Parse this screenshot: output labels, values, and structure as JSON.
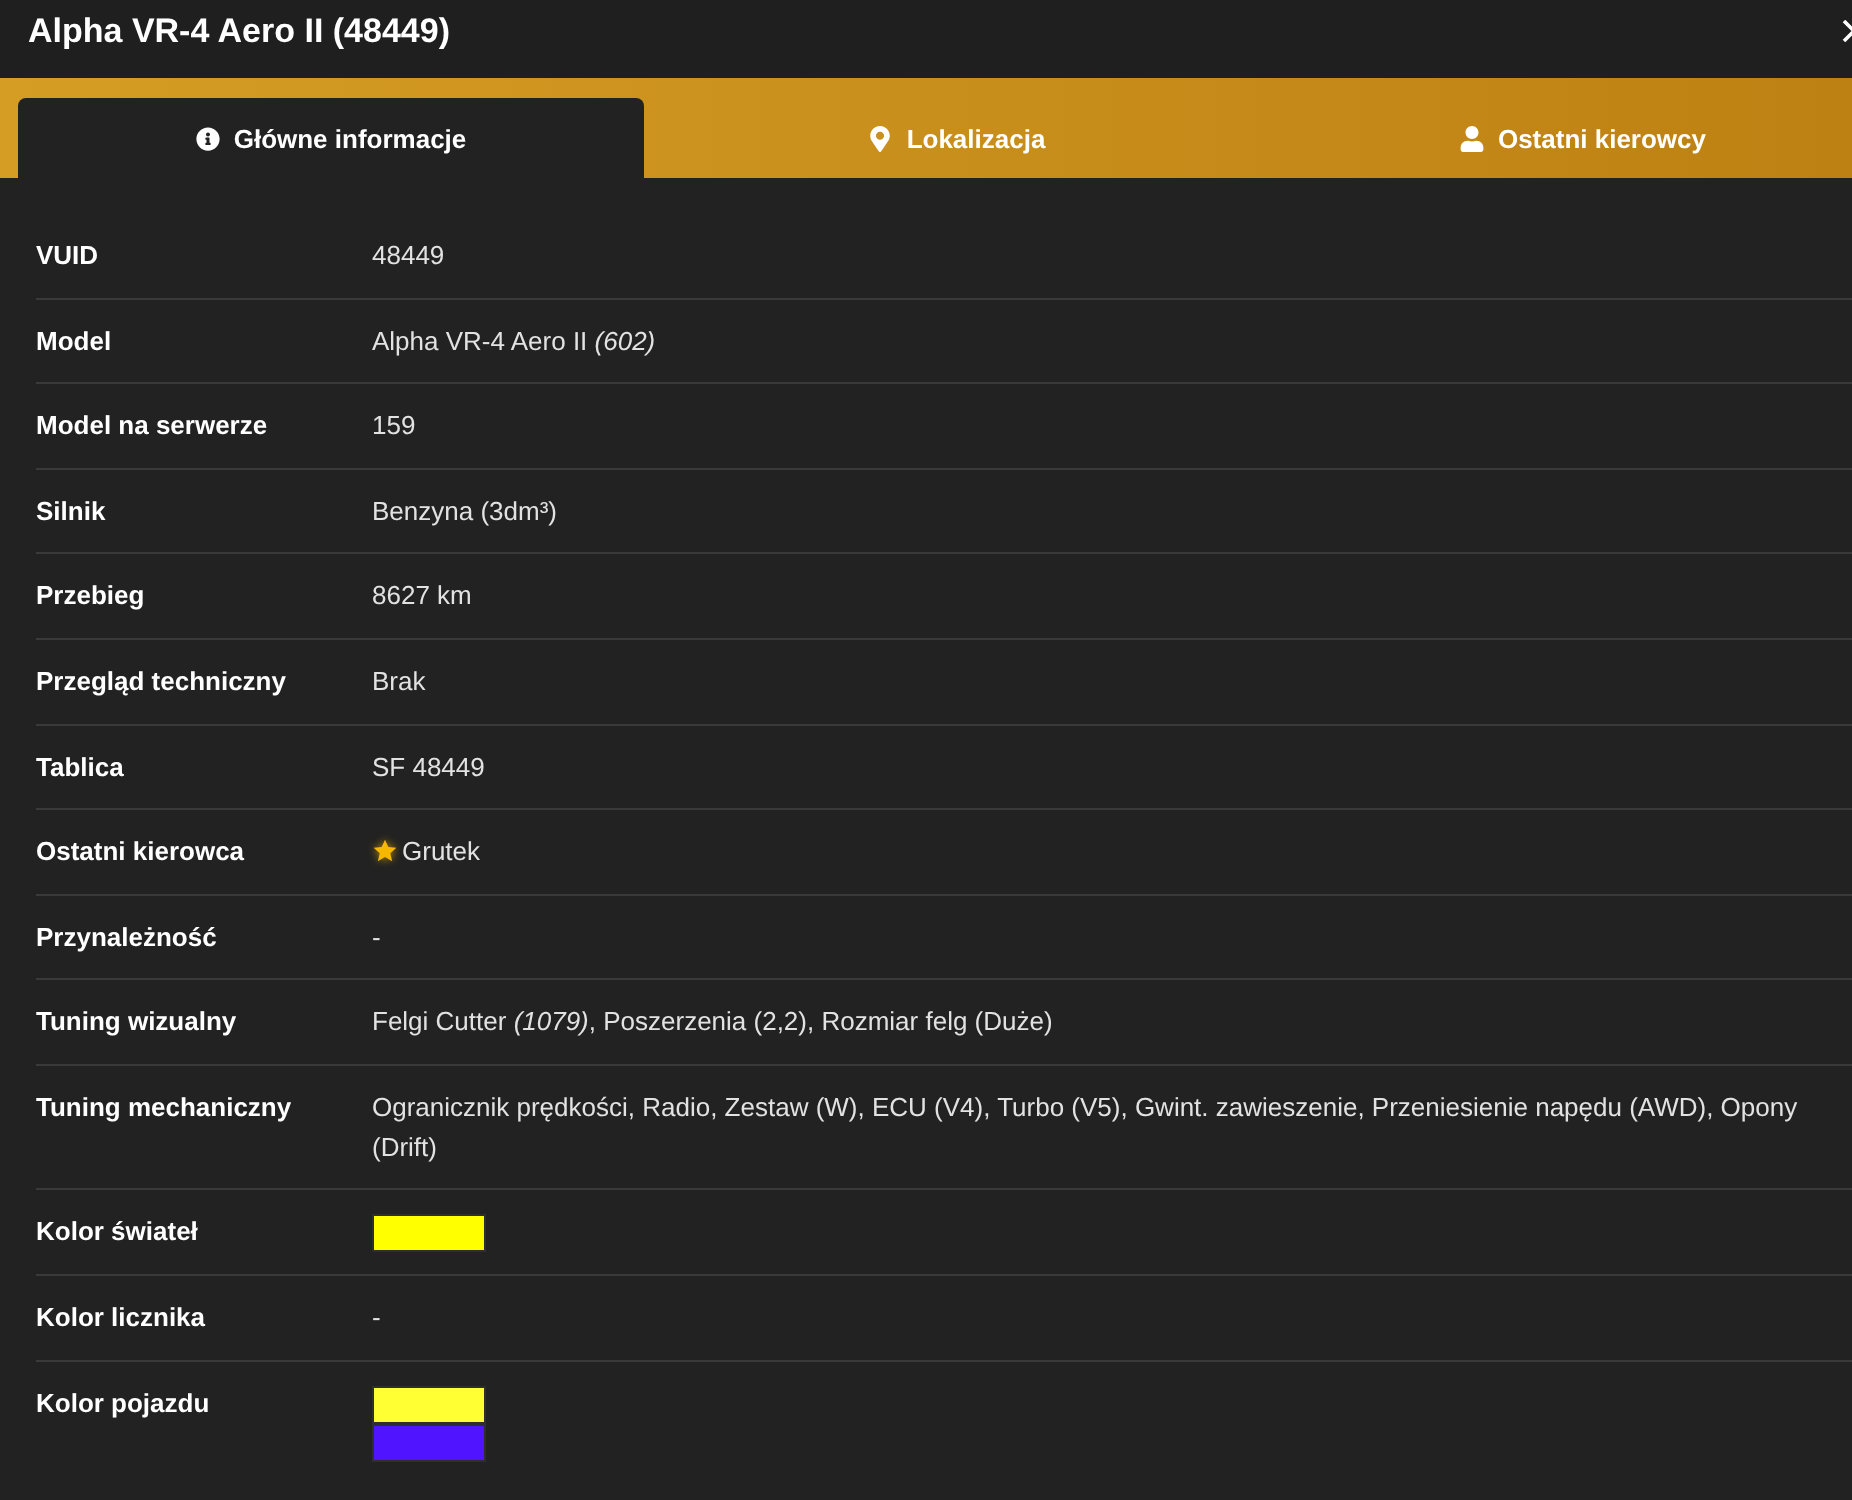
{
  "window": {
    "title": "Alpha VR-4 Aero II (48449)"
  },
  "tabs": [
    {
      "label": "Główne informacje",
      "selected": true
    },
    {
      "label": "Lokalizacja",
      "selected": false
    },
    {
      "label": "Ostatni kierowcy",
      "selected": false
    }
  ],
  "rows": [
    {
      "kind": "text",
      "label": "VUID",
      "value": "48449"
    },
    {
      "kind": "text",
      "label": "Model",
      "value": "Alpha VR-4 Aero II *(602)*"
    },
    {
      "kind": "text",
      "label": "Model na serwerze",
      "value": "159"
    },
    {
      "kind": "text",
      "label": "Silnik",
      "value": "Benzyna (3dm³)"
    },
    {
      "kind": "text",
      "label": "Przebieg",
      "value": "8627 km"
    },
    {
      "kind": "text",
      "label": "Przegląd techniczny",
      "value": "Brak"
    },
    {
      "kind": "text",
      "label": "Tablica",
      "value": "SF 48449"
    },
    {
      "kind": "driver",
      "label": "Ostatni kierowca",
      "value": "Grutek",
      "starred": true
    },
    {
      "kind": "text",
      "label": "Przynależność",
      "value": "-"
    },
    {
      "kind": "text",
      "label": "Tuning wizualny",
      "value": "Felgi Cutter *(1079)*, Poszerzenia (2,2), Rozmiar felg (Duże)"
    },
    {
      "kind": "text",
      "label": "Tuning mechaniczny",
      "value": "Ogranicznik prędkości, Radio, Zestaw (W), ECU (V4), Turbo (V5), Gwint. zawieszenie, Przeniesienie napędu (AWD), Opony (Drift)"
    },
    {
      "kind": "swatches",
      "label": "Kolor świateł",
      "swatches": [
        {
          "color": "#ffff00"
        }
      ]
    },
    {
      "kind": "text",
      "label": "Kolor licznika",
      "value": "-"
    },
    {
      "kind": "swatches",
      "label": "Kolor pojazdu",
      "swatches": [
        {
          "color": "#ffff33"
        },
        {
          "color": "#5014ff"
        }
      ]
    }
  ]
}
